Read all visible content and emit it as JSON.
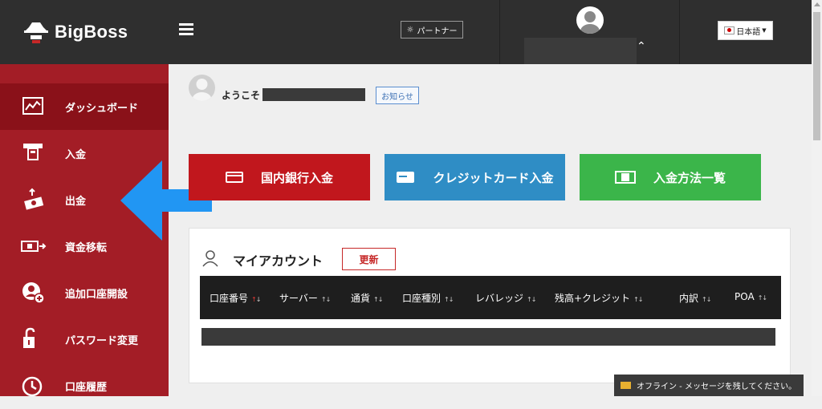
{
  "brand": {
    "logo_text": "BigBoss"
  },
  "header": {
    "partner_label": "パートナー",
    "language_label": "日本語"
  },
  "sidebar": {
    "items": [
      {
        "label": "ダッシュボード",
        "icon": "dashboard-chart-icon",
        "active": true
      },
      {
        "label": "入金",
        "icon": "atm-deposit-icon"
      },
      {
        "label": "出金",
        "icon": "money-withdraw-icon"
      },
      {
        "label": "資金移転",
        "icon": "money-transfer-icon"
      },
      {
        "label": "追加口座開設",
        "icon": "add-account-icon"
      },
      {
        "label": "パスワード変更",
        "icon": "unlock-icon"
      },
      {
        "label": "口座履歴",
        "icon": "clock-icon"
      }
    ]
  },
  "welcome": {
    "prefix": "ようこそ",
    "notice_label": "お知らせ"
  },
  "deposit_buttons": [
    {
      "label": "国内銀行入金",
      "color": "#c1171d",
      "icon": "bank-card-icon"
    },
    {
      "label": "クレジットカード入金",
      "color": "#2f8dc5",
      "icon": "credit-card-icon"
    },
    {
      "label": "入金方法一覧",
      "color": "#3bb54a",
      "icon": "cash-icon"
    }
  ],
  "account_card": {
    "title": "マイアカウント",
    "refresh_label": "更新",
    "columns": [
      "口座番号",
      "サーバー",
      "通貨",
      "口座種別",
      "レバレッジ",
      "残高+クレジット",
      "内訳",
      "POA"
    ]
  },
  "chat": {
    "status_text": "オフライン - メッセージを残してください。"
  },
  "colors": {
    "sidebar": "#a31d26",
    "topbar": "#2f2f2f",
    "annotation_arrow": "#2196f3"
  }
}
